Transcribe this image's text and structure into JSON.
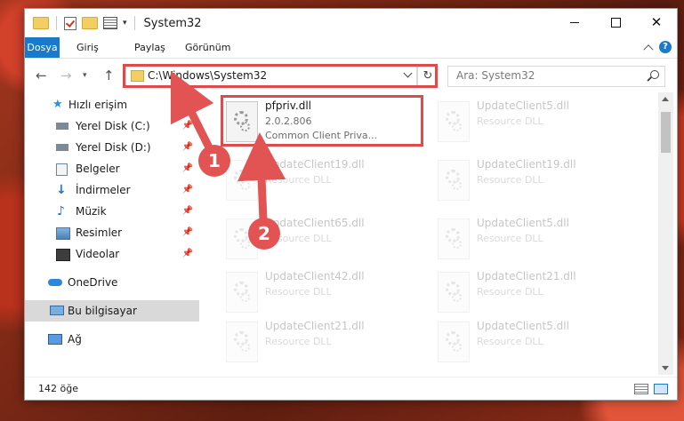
{
  "window": {
    "title": "System32"
  },
  "ribbon": {
    "tabs": [
      "Dosya",
      "Giriş",
      "Paylaş",
      "Görünüm"
    ],
    "help_label": "?"
  },
  "address_bar": {
    "path": "C:\\Windows\\System32",
    "refresh_glyph": "↻"
  },
  "search": {
    "placeholder": "Ara: System32"
  },
  "sidebar": {
    "items": [
      {
        "label": "Hızlı erişim"
      },
      {
        "label": "Yerel Disk (C:)"
      },
      {
        "label": "Yerel Disk (D:)"
      },
      {
        "label": "Belgeler"
      },
      {
        "label": "İndirmeler"
      },
      {
        "label": "Müzik"
      },
      {
        "label": "Resimler"
      },
      {
        "label": "Videolar"
      },
      {
        "label": "OneDrive"
      },
      {
        "label": "Bu bilgisayar"
      },
      {
        "label": "Ağ"
      }
    ]
  },
  "files": [
    {
      "name": "pfpriv.dll",
      "line2": "2.0.2.806",
      "line3": "Common Client Priva..."
    },
    {
      "name": "UpdateClient5.dll",
      "line2": "Resource DLL"
    },
    {
      "name": "UpdateClient19.dll",
      "line2": "Resource DLL"
    },
    {
      "name": "UpdateClient19.dll",
      "line2": "Resource DLL"
    },
    {
      "name": "UpdateClient65.dll",
      "line2": "Resource DLL"
    },
    {
      "name": "UpdateClient5.dll",
      "line2": "Resource DLL"
    },
    {
      "name": "UpdateClient42.dll",
      "line2": "Resource DLL"
    },
    {
      "name": "UpdateClient21.dll",
      "line2": "Resource DLL"
    },
    {
      "name": "UpdateClient21.dll",
      "line2": "Resource DLL"
    },
    {
      "name": "UpdateClient5.dll",
      "line2": "Resource DLL"
    }
  ],
  "status_bar": {
    "item_count": "142 öğe"
  },
  "annotations": {
    "badge1": "1",
    "badge2": "2"
  },
  "colors": {
    "accent": "#1979ca",
    "highlight": "#dd4b4b"
  }
}
